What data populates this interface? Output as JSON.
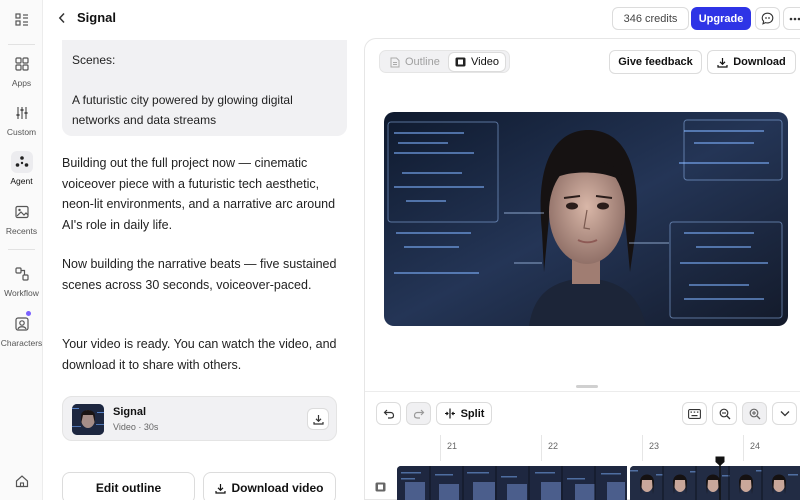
{
  "app": {
    "title": "Signal"
  },
  "rail": {
    "items": [
      {
        "label": "Apps"
      },
      {
        "label": "Custom"
      },
      {
        "label": "Agent"
      },
      {
        "label": "Recents"
      },
      {
        "label": "Workflow"
      },
      {
        "label": "Characters"
      }
    ]
  },
  "header": {
    "credits": "346 credits",
    "upgrade": "Upgrade"
  },
  "chat": {
    "bubble_heading": "Scenes:",
    "bubble_text": "A futuristic city powered by glowing digital networks and data streams",
    "messages": [
      "Building out the full project now — cinematic voiceover piece with a futuristic tech aesthetic, neon-lit environments, and a narrative arc around AI's role in daily life.",
      "Now building the narrative beats — five sustained scenes across 30 seconds, voiceover-paced.",
      "Your video is ready. You can watch the video, and download it to share with others."
    ],
    "video_card": {
      "title": "Signal",
      "subtitle": "Video · 30s"
    },
    "edit_outline": "Edit outline",
    "download_video": "Download video"
  },
  "panel": {
    "tabs": [
      {
        "label": "Outline"
      },
      {
        "label": "Video"
      }
    ],
    "active_tab": "Video",
    "feedback": "Give feedback",
    "download": "Download"
  },
  "timeline": {
    "split": "Split",
    "ruler": [
      "21",
      "22",
      "23",
      "24"
    ]
  },
  "colors": {
    "accent": "#2e34e6",
    "badge": "#7b61ff"
  }
}
